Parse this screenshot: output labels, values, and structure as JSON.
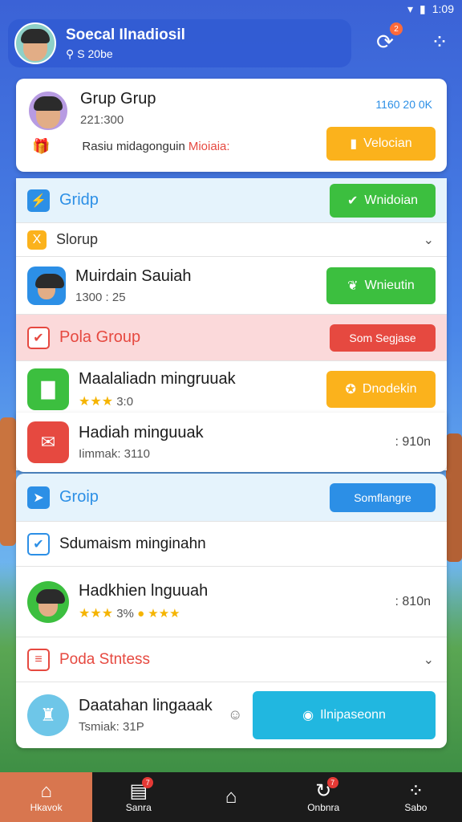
{
  "status": {
    "time": "1:09"
  },
  "header": {
    "title": "Soecal Ilnadiosil",
    "subtitle": "S 20be",
    "search_icon": "search-icon"
  },
  "profile": {
    "name": "Grup Grup",
    "count": "221:300",
    "meta": "1160 20 0K",
    "desc_prefix": "Rasiu midagonguin",
    "desc_highlight": "Mioiaia:",
    "button": "Velocian"
  },
  "section1": {
    "label": "Gridp",
    "button": "Wnidoian"
  },
  "subsection1": {
    "label": "Slorup"
  },
  "item1": {
    "title": "Muirdain Sauiah",
    "sub": "1300 : 25",
    "button": "Wnieutin"
  },
  "section2": {
    "label": "Pola Group",
    "button": "Som Segjase"
  },
  "item2": {
    "title": "Maalaliadn mingruuak",
    "rating": "★★★",
    "sub": "3:0",
    "button": "Dnodekin"
  },
  "item3": {
    "title": "Hadiah minguuak",
    "sub": "Iimmak: 3110",
    "right": ": 910n"
  },
  "section3": {
    "label": "Groip",
    "button": "Somflangre"
  },
  "item4": {
    "title": "Sdumaism minginahn"
  },
  "item5": {
    "title": "Hadkhien lnguuah",
    "rating": "★★★",
    "sub": "3%",
    "right": ": 810n"
  },
  "section4": {
    "label": "Poda Stntess"
  },
  "item6": {
    "title": "Daatahan lingaaak",
    "sub": "Tsmiak: 31P",
    "button": "Ilnipaseonn"
  },
  "nav": [
    {
      "label": "Hkavok"
    },
    {
      "label": "Sanra",
      "badge": "7"
    },
    {
      "label": ""
    },
    {
      "label": "Onbnra",
      "badge": "7"
    },
    {
      "label": "Sabo"
    }
  ],
  "colors": {
    "blue": "#2c8fe6",
    "green": "#3cbf3f",
    "orange": "#fbb21c",
    "red": "#e64940",
    "cyan": "#21b7e0"
  }
}
